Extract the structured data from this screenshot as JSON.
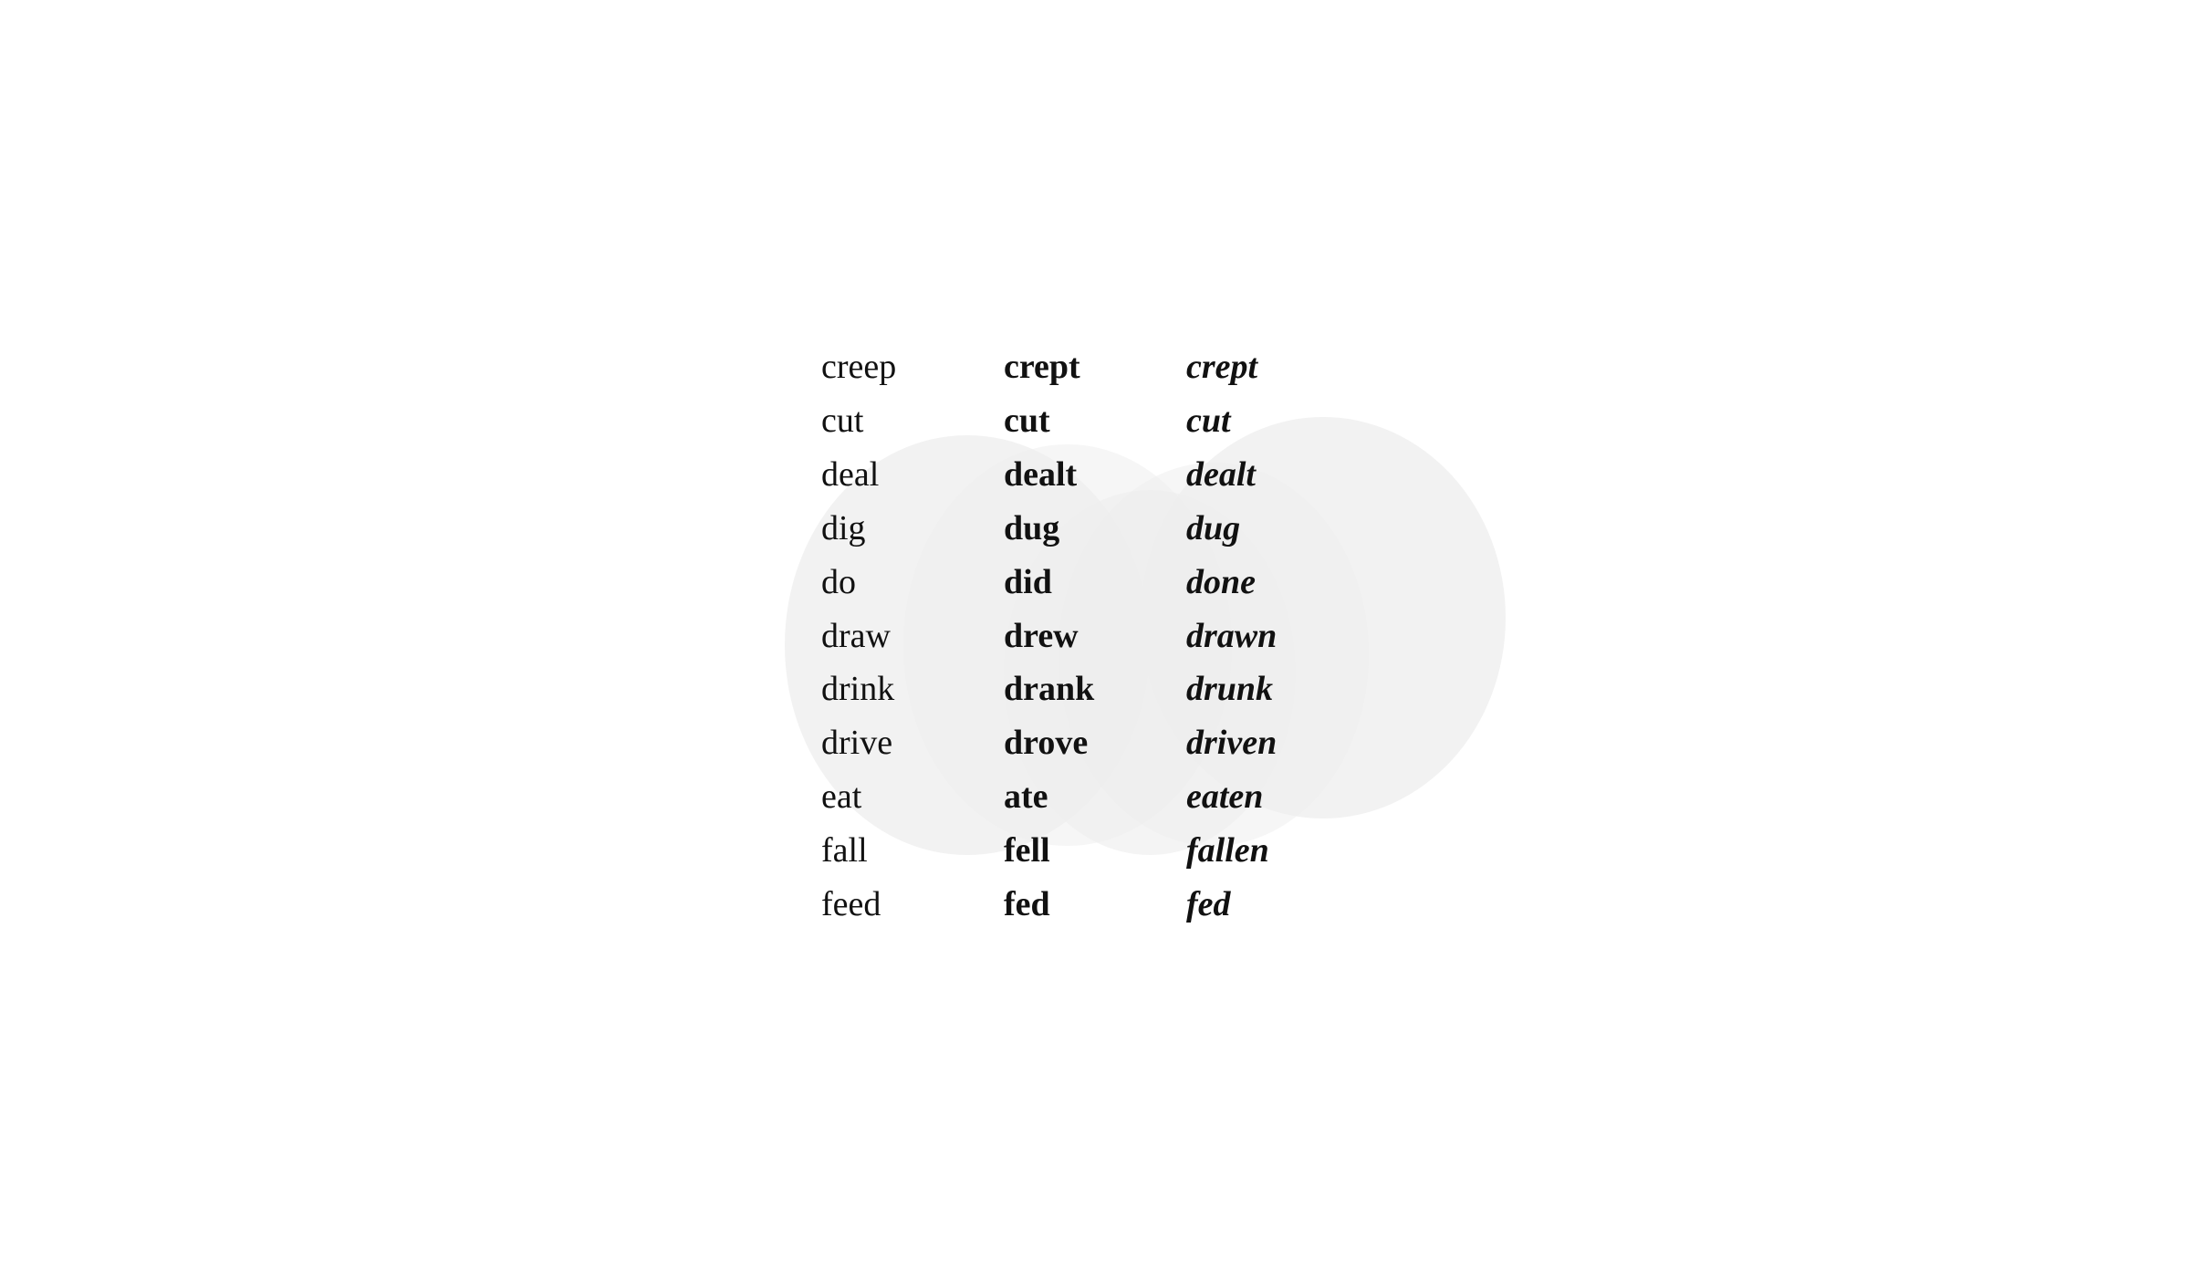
{
  "verbs": [
    {
      "base": "creep",
      "past": "crept",
      "participle": "crept"
    },
    {
      "base": "cut",
      "past": "cut",
      "participle": "cut"
    },
    {
      "base": "deal",
      "past": "dealt",
      "participle": "dealt"
    },
    {
      "base": "dig",
      "past": "dug",
      "participle": "dug"
    },
    {
      "base": "do",
      "past": "did",
      "participle": "done"
    },
    {
      "base": "draw",
      "past": "drew",
      "participle": "drawn"
    },
    {
      "base": "drink",
      "past": "drank",
      "participle": "drunk"
    },
    {
      "base": "drive",
      "past": "drove",
      "participle": "driven"
    },
    {
      "base": "eat",
      "past": "ate",
      "participle": "eaten"
    },
    {
      "base": "fall",
      "past": "fell",
      "participle": "fallen"
    },
    {
      "base": "feed",
      "past": "fed",
      "participle": "fed"
    }
  ]
}
